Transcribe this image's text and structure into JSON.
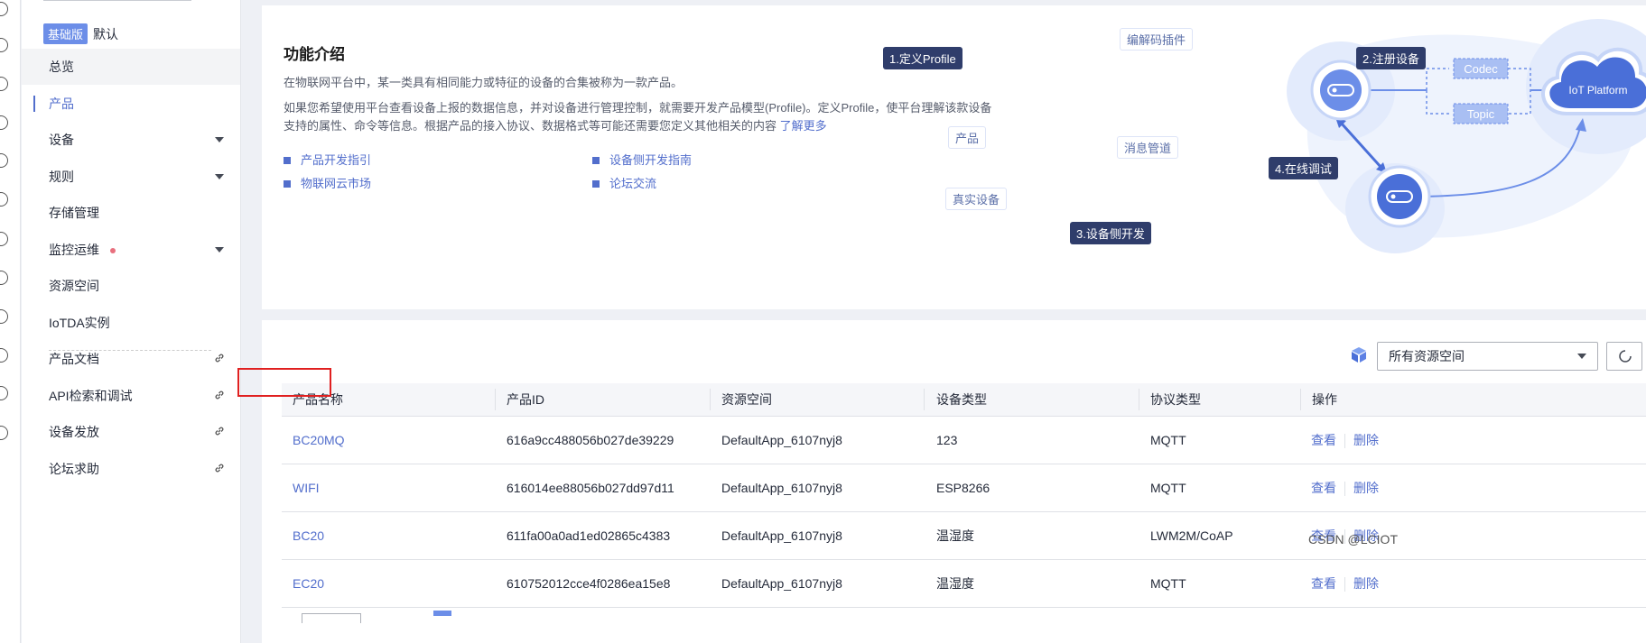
{
  "sidebar": {
    "edition_badge": "基础版",
    "edition_name": "默认",
    "items": [
      {
        "label": "总览"
      },
      {
        "label": "产品"
      },
      {
        "label": "设备"
      },
      {
        "label": "规则"
      },
      {
        "label": "存储管理"
      },
      {
        "label": "监控运维"
      },
      {
        "label": "资源空间"
      },
      {
        "label": "IoTDA实例"
      },
      {
        "label": "产品文档"
      },
      {
        "label": "API检索和调试"
      },
      {
        "label": "设备发放"
      },
      {
        "label": "论坛求助"
      }
    ]
  },
  "intro": {
    "title": "功能介绍",
    "p1": "在物联网平台中，某一类具有相同能力或特征的设备的合集被称为一款产品。",
    "p2": "如果您希望使用平台查看设备上报的数据信息，并对设备进行管理控制，就需要开发产品模型(Profile)。定义Profile，使平台理解该款设备支持的属性、命令等信息。根据产品的接入协议、数据格式等可能还需要您定义其他相关的内容",
    "more": "了解更多",
    "links": [
      "产品开发指引",
      "设备侧开发指南",
      "物联网云市场",
      "论坛交流"
    ]
  },
  "diagram": {
    "step1": "1.定义Profile",
    "step2": "2.注册设备",
    "step3": "3.设备侧开发",
    "step4": "4.在线调试",
    "codec_plugin": "编解码插件",
    "codec": "Codec",
    "topic": "Topic",
    "msg_pipe": "消息管道",
    "platform": "IoT Platform",
    "product": "产品",
    "real_device": "真实设备"
  },
  "filter": {
    "resource_space": "所有资源空间"
  },
  "table": {
    "headers": [
      "产品名称",
      "产品ID",
      "资源空间",
      "设备类型",
      "协议类型",
      "操作"
    ],
    "rows": [
      {
        "name": "BC20MQ",
        "id": "616a9cc488056b027de39229",
        "space": "DefaultApp_6107nyj8",
        "type": "123",
        "protocol": "MQTT"
      },
      {
        "name": "WIFI",
        "id": "616014ee88056b027dd97d11",
        "space": "DefaultApp_6107nyj8",
        "type": "ESP8266",
        "protocol": "MQTT"
      },
      {
        "name": "BC20",
        "id": "611fa00a0ad1ed02865c4383",
        "space": "DefaultApp_6107nyj8",
        "type": "温湿度",
        "protocol": "LWM2M/CoAP"
      },
      {
        "name": "EC20",
        "id": "610752012cce4f0286ea15e8",
        "space": "DefaultApp_6107nyj8",
        "type": "温湿度",
        "protocol": "MQTT"
      }
    ],
    "op_view": "查看",
    "op_delete": "删除"
  },
  "watermark": "CSDN @LCIOT"
}
